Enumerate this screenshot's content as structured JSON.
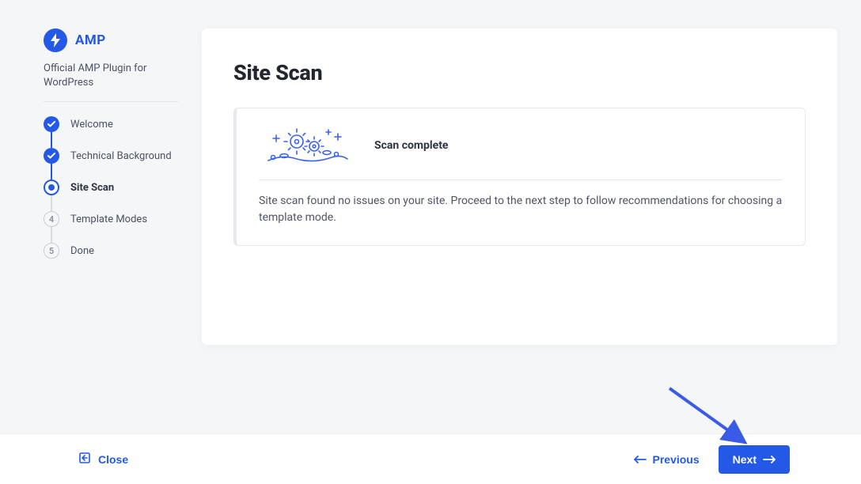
{
  "sidebar": {
    "brand": "AMP",
    "tagline": "Official AMP Plugin for WordPress",
    "steps": [
      {
        "label": "Welcome",
        "state": "done"
      },
      {
        "label": "Technical Background",
        "state": "done"
      },
      {
        "label": "Site Scan",
        "state": "current"
      },
      {
        "label": "Template Modes",
        "state": "pending",
        "num": "4"
      },
      {
        "label": "Done",
        "state": "pending",
        "num": "5"
      }
    ]
  },
  "main": {
    "title": "Site Scan",
    "status": "Scan complete",
    "description": "Site scan found no issues on your site. Proceed to the next step to follow recommendations for choosing a template mode."
  },
  "footer": {
    "close": "Close",
    "previous": "Previous",
    "next": "Next"
  },
  "colors": {
    "accent": "#2459e7"
  }
}
